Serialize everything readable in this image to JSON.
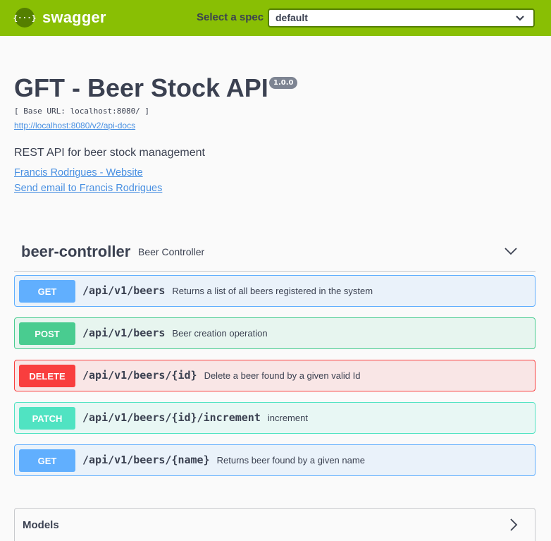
{
  "topbar": {
    "logo_glyph": "{···}",
    "logo_text": "swagger",
    "spec_label": "Select a spec",
    "spec_value": "default"
  },
  "info": {
    "title": "GFT - Beer Stock API",
    "version": "1.0.0",
    "base_url": "[ Base URL: localhost:8080/ ]",
    "docs_url": "http://localhost:8080/v2/api-docs",
    "description": "REST API for beer stock management",
    "contact_website": "Francis Rodrigues - Website",
    "contact_email": "Send email to Francis Rodrigues"
  },
  "tag": {
    "name": "beer-controller",
    "description": "Beer Controller"
  },
  "operations": [
    {
      "method": "GET",
      "path": "/api/v1/beers",
      "summary": "Returns a list of all beers registered in the system"
    },
    {
      "method": "POST",
      "path": "/api/v1/beers",
      "summary": "Beer creation operation"
    },
    {
      "method": "DELETE",
      "path": "/api/v1/beers/{id}",
      "summary": "Delete a beer found by a given valid Id"
    },
    {
      "method": "PATCH",
      "path": "/api/v1/beers/{id}/increment",
      "summary": "increment"
    },
    {
      "method": "GET",
      "path": "/api/v1/beers/{name}",
      "summary": "Returns beer found by a given name"
    }
  ],
  "models": {
    "title": "Models"
  },
  "colors": {
    "topbar": "#89bf04",
    "get": "#61affe",
    "post": "#49cc90",
    "delete": "#f93e3e",
    "patch": "#50e3c2",
    "link": "#4990e2"
  }
}
